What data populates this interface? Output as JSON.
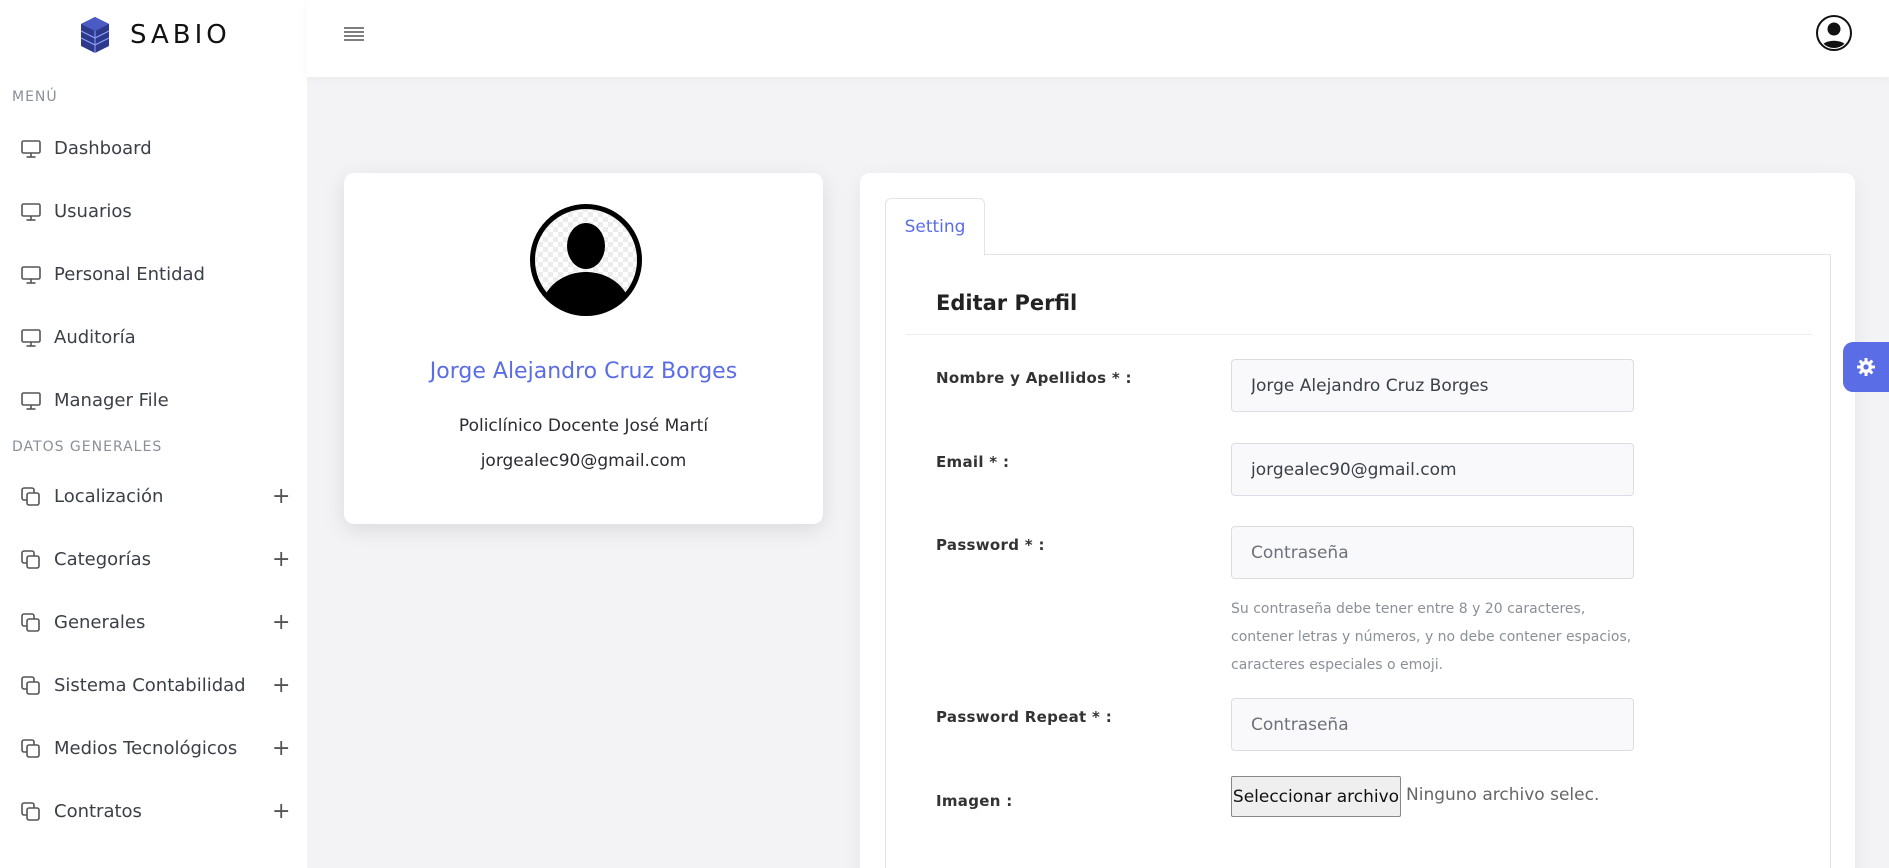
{
  "brand": {
    "name": "SABIO",
    "accent": "#5b6de6"
  },
  "sidebar": {
    "sections": [
      {
        "title": "MENÚ",
        "items": [
          {
            "label": "Dashboard",
            "icon": "monitor-icon"
          },
          {
            "label": "Usuarios",
            "icon": "monitor-icon"
          },
          {
            "label": "Personal Entidad",
            "icon": "monitor-icon"
          },
          {
            "label": "Auditoría",
            "icon": "monitor-icon"
          },
          {
            "label": "Manager File",
            "icon": "monitor-icon"
          }
        ]
      },
      {
        "title": "DATOS GENERALES",
        "items": [
          {
            "label": "Localización",
            "icon": "copy-icon",
            "expander": "+"
          },
          {
            "label": "Categorías",
            "icon": "copy-icon",
            "expander": "+"
          },
          {
            "label": "Generales",
            "icon": "copy-icon",
            "expander": "+"
          },
          {
            "label": "Sistema Contabilidad",
            "icon": "copy-icon",
            "expander": "+"
          },
          {
            "label": "Medios Tecnológicos",
            "icon": "copy-icon",
            "expander": "+"
          },
          {
            "label": "Contratos",
            "icon": "copy-icon",
            "expander": "+"
          }
        ]
      }
    ]
  },
  "profile": {
    "name": "Jorge Alejandro Cruz Borges",
    "entity": "Policlínico Docente José Martí",
    "email": "jorgealec90@gmail.com"
  },
  "settings": {
    "tab_label": "Setting",
    "form_title": "Editar Perfil",
    "fields": {
      "name": {
        "label": "Nombre y Apellidos * :",
        "value": "Jorge Alejandro Cruz Borges"
      },
      "email": {
        "label": "Email * :",
        "value": "jorgealec90@gmail.com"
      },
      "password": {
        "label": "Password * :",
        "placeholder": "Contraseña"
      },
      "password_repeat": {
        "label": "Password Repeat * :",
        "placeholder": "Contraseña"
      },
      "image": {
        "label": "Imagen :",
        "button": "Seleccionar archivo",
        "status": "Ninguno archivo selec."
      }
    },
    "password_hint": "Su contraseña debe tener entre 8 y 20 caracteres, contener letras y números, y no debe contener espacios, caracteres especiales o emoji."
  }
}
